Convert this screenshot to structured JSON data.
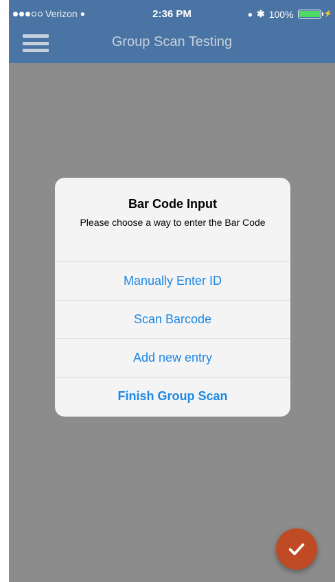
{
  "status_bar": {
    "carrier": "Verizon",
    "time": "2:36 PM",
    "battery": "100%"
  },
  "nav": {
    "title": "Group Scan Testing",
    "menu_icon": "hamburger-icon"
  },
  "dialog": {
    "title": "Bar Code Input",
    "message": "Please choose a way to enter the Bar Code",
    "actions": [
      {
        "label": "Manually Enter ID"
      },
      {
        "label": "Scan Barcode"
      },
      {
        "label": "Add new entry"
      },
      {
        "label": "Finish Group Scan"
      }
    ]
  },
  "fab": {
    "icon": "checkmark-icon"
  },
  "colors": {
    "nav_background": "#4a74a3",
    "overlay": "#8c8c8c",
    "dialog_action": "#1e88e5",
    "fab": "#bf4a23",
    "battery_fill": "#4cd964"
  }
}
